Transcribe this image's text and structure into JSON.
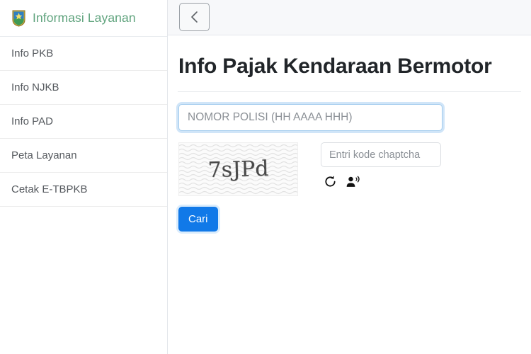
{
  "sidebar": {
    "brand": {
      "title": "Informasi Layanan",
      "logo_icon": "provincial-crest-icon",
      "color": "#5fa37d"
    },
    "items": [
      {
        "label": "Info PKB",
        "name": "sidebar-item-info-pkb"
      },
      {
        "label": "Info NJKB",
        "name": "sidebar-item-info-njkb"
      },
      {
        "label": "Info PAD",
        "name": "sidebar-item-info-pad"
      },
      {
        "label": "Peta Layanan",
        "name": "sidebar-item-peta-layanan"
      },
      {
        "label": "Cetak E-TBPKB",
        "name": "sidebar-item-cetak-etbpkb"
      }
    ]
  },
  "topbar": {
    "back_button_icon": "chevron-left-icon",
    "back_button_label": ""
  },
  "main": {
    "page_title": "Info Pajak Kendaraan Bermotor",
    "plate_input": {
      "placeholder": "NOMOR POLISI (HH AAAA HHH)",
      "value": "",
      "focused": true,
      "focus_color": "#a5cdee"
    },
    "captcha": {
      "code_text": "7sJPd",
      "characters": [
        "7",
        "s",
        "J",
        "P",
        "d"
      ],
      "input_placeholder": "Entri kode chaptcha",
      "input_value": "",
      "refresh_icon": "refresh-icon",
      "audio_icon": "audio-speaker-person-icon"
    },
    "submit": {
      "label": "Cari",
      "color": "#1179e8"
    }
  }
}
